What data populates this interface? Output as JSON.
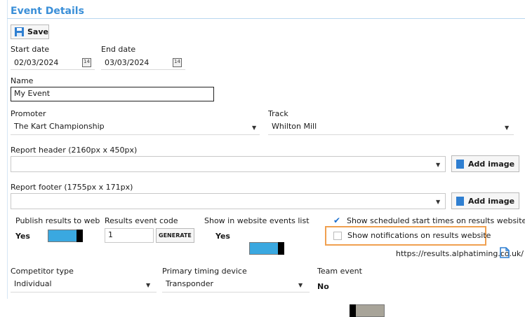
{
  "section": {
    "title": "Event Details"
  },
  "toolbar": {
    "save_label": "Save"
  },
  "dates": {
    "start_label": "Start date",
    "start_value": "02/03/2024",
    "end_label": "End date",
    "end_value": "03/03/2024",
    "calendar_glyph": "14"
  },
  "name": {
    "label": "Name",
    "value": "My Event"
  },
  "promoter": {
    "label": "Promoter",
    "value": "The Kart Championship"
  },
  "track": {
    "label": "Track",
    "value": "Whilton Mill"
  },
  "report_header": {
    "label": "Report header (2160px x 450px)",
    "value": "",
    "add_label": "Add image"
  },
  "report_footer": {
    "label": "Report footer (1755px x 171px)",
    "value": "",
    "add_label": "Add image"
  },
  "publish": {
    "label": "Publish results to web",
    "value": "Yes",
    "on": true
  },
  "results_code": {
    "label": "Results event code",
    "value": "1",
    "generate_label": "GENERATE"
  },
  "show_list": {
    "label": "Show in website events list",
    "value": "Yes",
    "on": true
  },
  "show_start_times": {
    "label": "Show scheduled start times on results website",
    "checked": true
  },
  "show_notifications": {
    "label": "Show notifications on results website",
    "checked": false
  },
  "results_url": "https://results.alphatiming.co.uk/",
  "competitor_type": {
    "label": "Competitor type",
    "value": "Individual"
  },
  "timing_device": {
    "label": "Primary timing device",
    "value": "Transponder"
  },
  "team_event": {
    "label": "Team event",
    "value": "No",
    "on": false
  },
  "colors": {
    "accent": "#3a8fd8",
    "toggle_on": "#3aa8e0",
    "toggle_off": "#a8a499",
    "highlight": "#f0a050"
  }
}
